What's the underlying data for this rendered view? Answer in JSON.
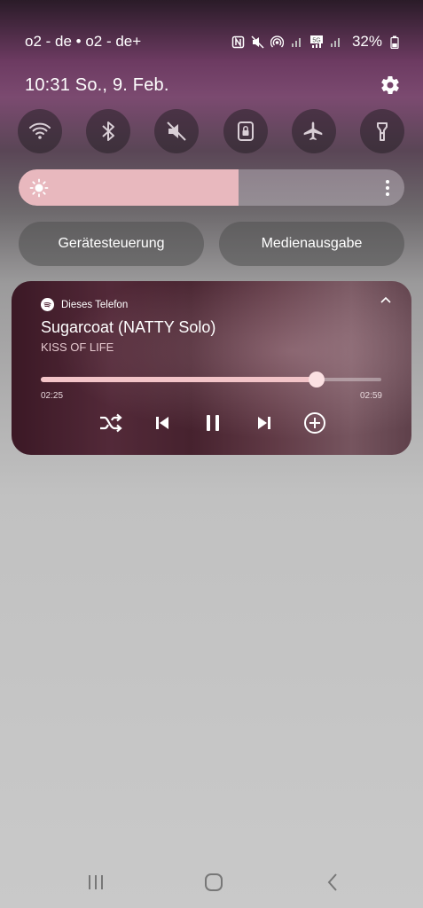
{
  "status_bar": {
    "carriers": "o2 - de • o2 - de+",
    "battery": "32%",
    "icons": [
      "nfc-icon",
      "mute-icon",
      "hotspot-icon",
      "signal-icon",
      "5g-icon",
      "signal-icon",
      "battery-icon"
    ]
  },
  "header": {
    "datetime": "10:31  So., 9. Feb.",
    "settings_icon": "gear-icon"
  },
  "quick_settings": [
    {
      "name": "wifi",
      "icon": "wifi-icon"
    },
    {
      "name": "bluetooth",
      "icon": "bluetooth-icon"
    },
    {
      "name": "sound",
      "icon": "mute-icon"
    },
    {
      "name": "rotation",
      "icon": "rotation-lock-icon"
    },
    {
      "name": "airplane",
      "icon": "airplane-icon"
    },
    {
      "name": "flashlight",
      "icon": "flashlight-icon"
    }
  ],
  "brightness": {
    "level": 0.57
  },
  "buttons": {
    "device_control": "Gerätesteuerung",
    "media_output": "Medienausgabe"
  },
  "media": {
    "source": "Dieses Telefon",
    "title": "Sugarcoat (NATTY Solo)",
    "artist": "KISS OF LIFE",
    "elapsed": "02:25",
    "total": "02:59",
    "progress": 0.81
  },
  "colors": {
    "accent": "#f3c4c8",
    "brightness_fill": "#e8b8be"
  }
}
